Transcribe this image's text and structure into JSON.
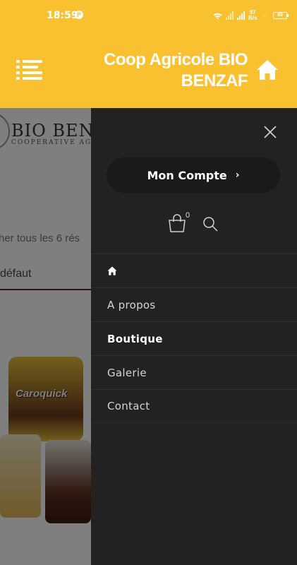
{
  "status_bar": {
    "time": "18:59",
    "p_badge": "P",
    "net_speed_value": "97",
    "net_speed_unit": "B/s",
    "battery": "89"
  },
  "header": {
    "title": "Coop Agricole BIO BENZAF"
  },
  "background_page": {
    "logo_text": "BIO BEN",
    "logo_subtext": "COOPERATIVE AG",
    "results_text": "her tous les 6 rés",
    "sort_text": "défaut",
    "product_label": "Caroquick"
  },
  "drawer": {
    "account_button": "Mon Compte",
    "account_chevron": "›",
    "cart_count": "0",
    "nav_items": [
      {
        "label": "A propos"
      },
      {
        "label": "Boutique"
      },
      {
        "label": "Galerie"
      },
      {
        "label": "Contact"
      }
    ]
  },
  "colors": {
    "brand_yellow": "#f9c130",
    "drawer_bg": "#222222"
  }
}
